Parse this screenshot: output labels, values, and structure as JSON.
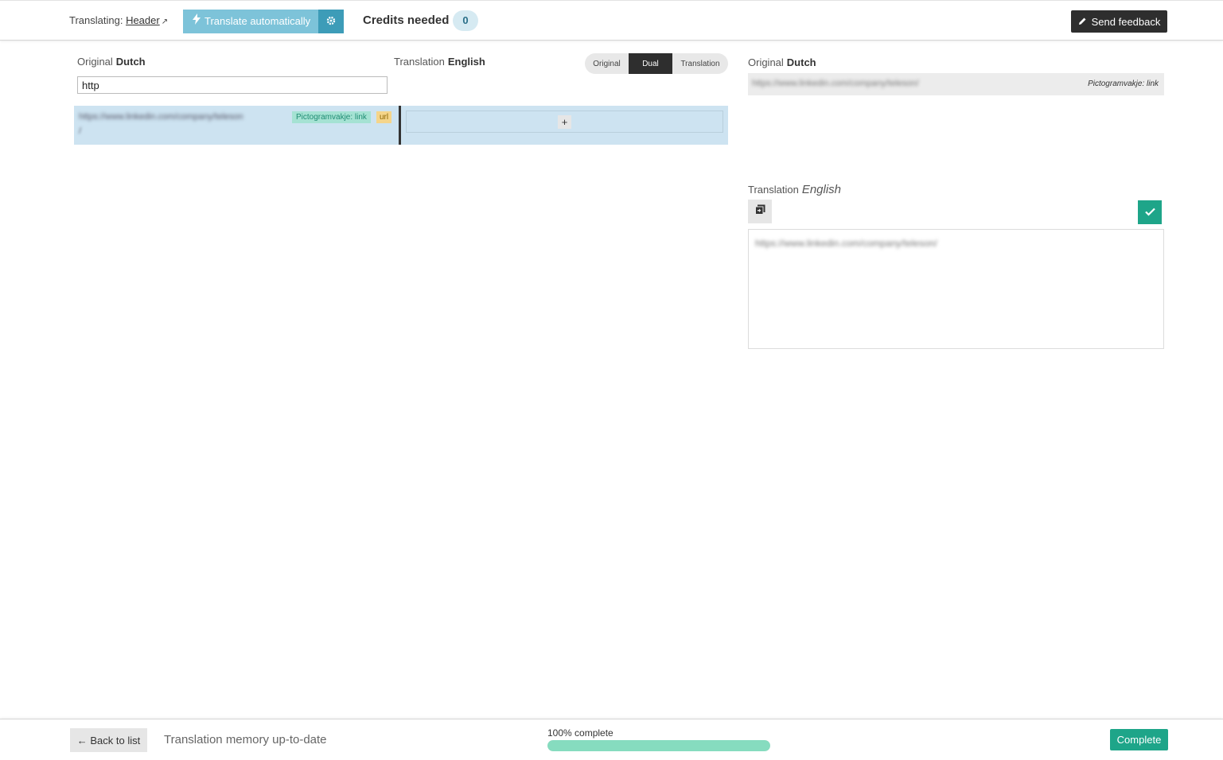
{
  "header": {
    "translating_label": "Translating:",
    "translating_link": "Header",
    "translate_auto_label": "Translate automatically",
    "credits_label": "Credits needed",
    "credits_value": "0",
    "feedback_label": "Send feedback"
  },
  "left_panel": {
    "original_label": "Original",
    "original_lang": "Dutch",
    "translation_label": "Translation",
    "translation_lang": "English",
    "search_value": "http",
    "view_toggle": {
      "original": "Original",
      "dual": "Dual",
      "translation": "Translation",
      "selected": "Dual"
    },
    "segment": {
      "source_text": "https://www.linkedin.com/company/teleson",
      "source_text_cont": "/",
      "context_tag": "Pictogramvakje: link",
      "type_tag": "url",
      "add_label": "+"
    }
  },
  "right_panel": {
    "original_label": "Original",
    "original_lang": "Dutch",
    "source_text": "https://www.linkedin.com/company/teleson/",
    "context_label": "Pictogramvakje: link",
    "translation_label": "Translation",
    "translation_lang": "English",
    "editor_text": "https://www.linkedin.com/company/teleson/"
  },
  "footer": {
    "back_label": "← Back to list",
    "tm_status": "Translation memory up-to-date",
    "progress_label": "100% complete",
    "progress_fraction": 1.0,
    "complete_label": "Complete"
  },
  "colors": {
    "accent_teal": "#1ea589",
    "auto_translate_blue": "#7dc3d9",
    "selected_row": "#cde3f1",
    "progress_fill": "#86dcbf"
  },
  "icons": [
    "external-link-icon",
    "lightning-icon",
    "gear-icon",
    "pencil-icon",
    "copy-icon",
    "check-icon"
  ]
}
